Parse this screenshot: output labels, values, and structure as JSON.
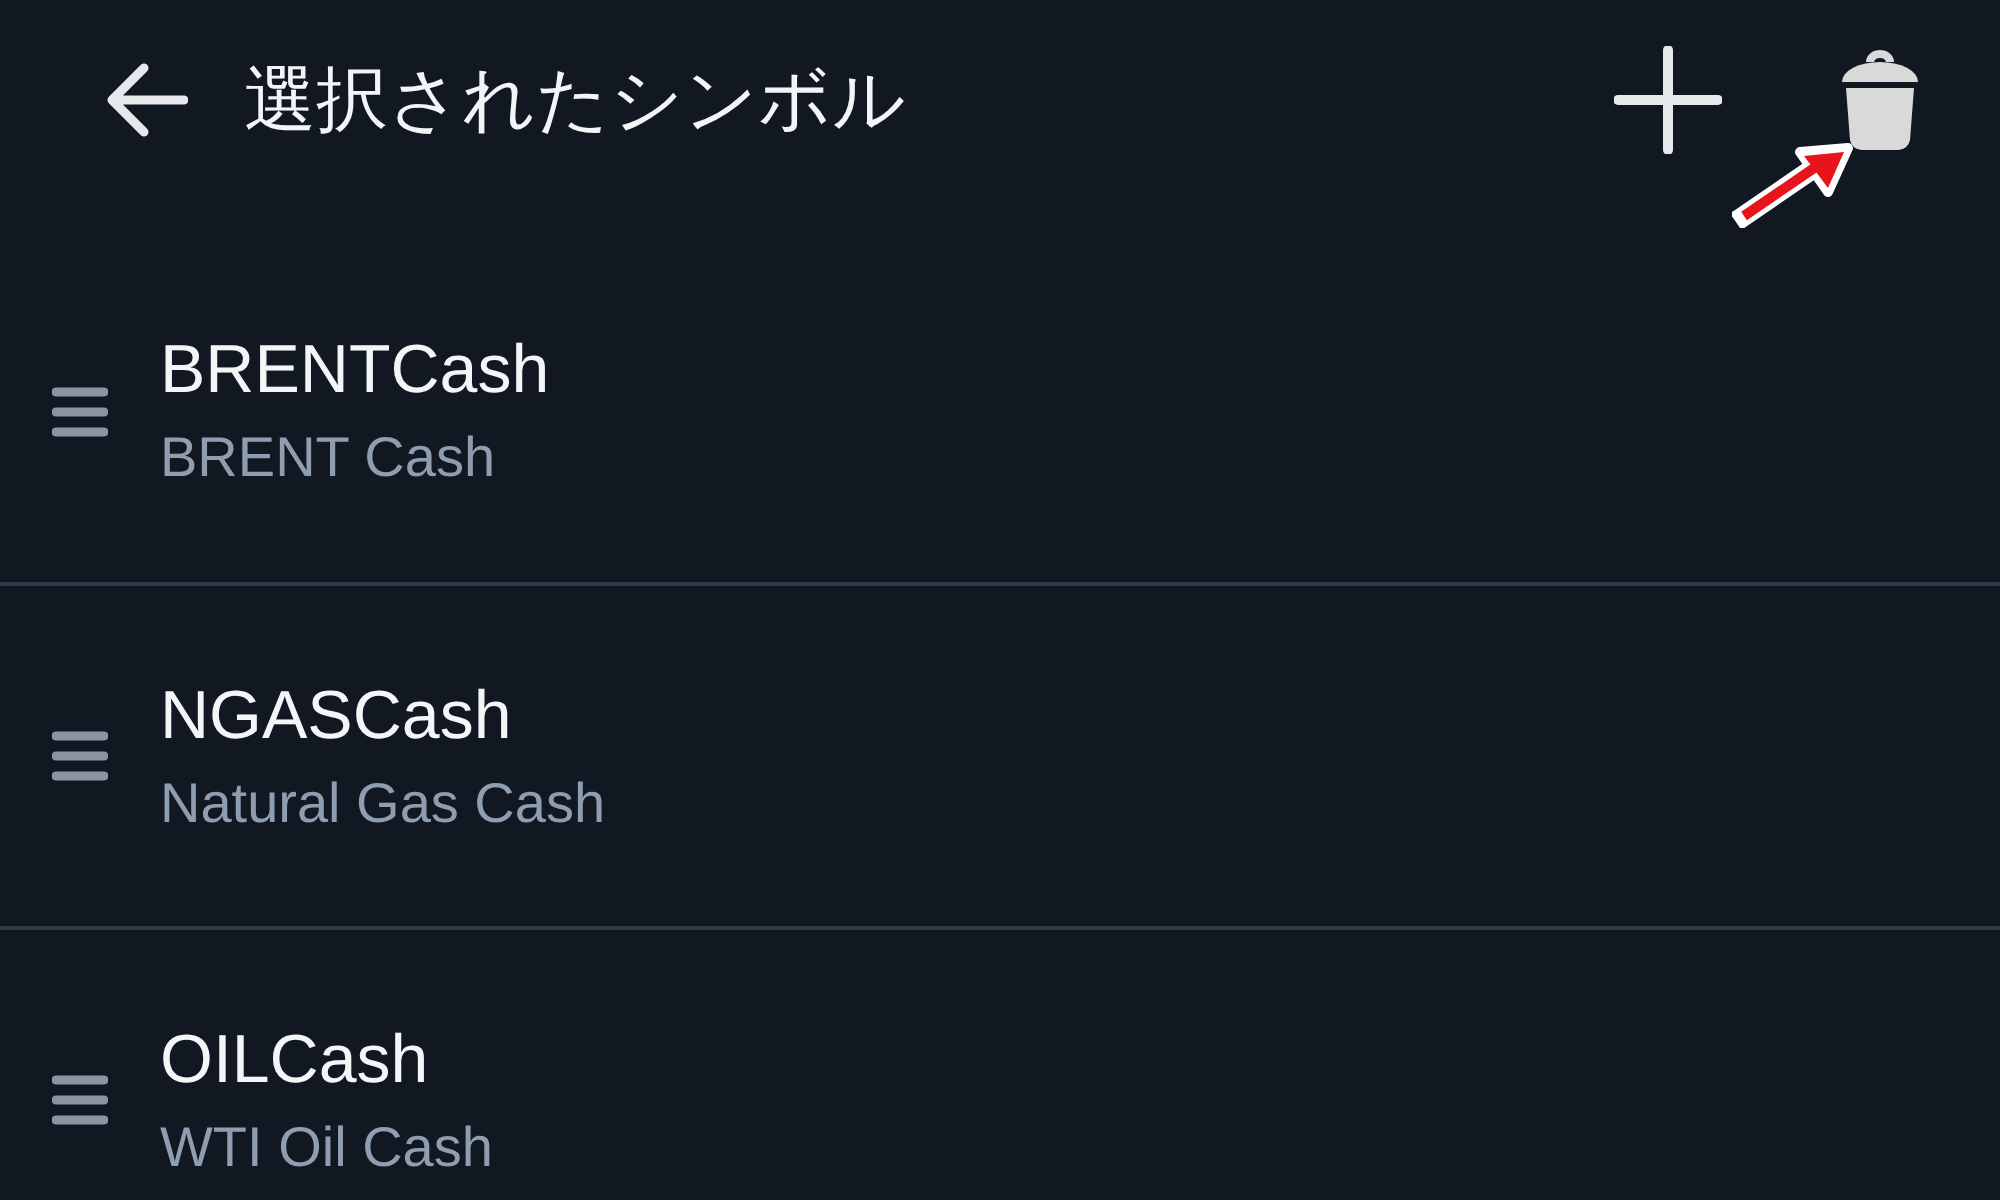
{
  "app_bar": {
    "title": "選択されたシンボル"
  },
  "symbols": [
    {
      "symbol": "BRENTCash",
      "description": "BRENT Cash"
    },
    {
      "symbol": "NGASCash",
      "description": "Natural Gas Cash"
    },
    {
      "symbol": "OILCash",
      "description": "WTI Oil Cash"
    }
  ]
}
